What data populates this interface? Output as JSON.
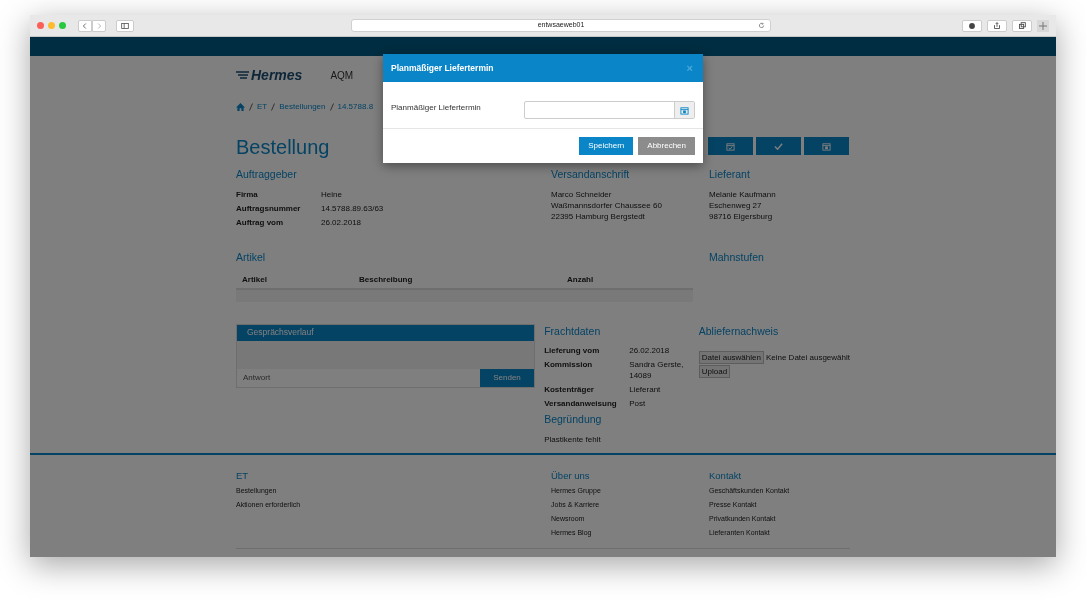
{
  "browser": {
    "url": "entwsaeweb01"
  },
  "header": {
    "logo": "Hermes",
    "app": "AQM"
  },
  "breadcrumb": [
    "ET",
    "Bestellungen",
    "14.5788.8"
  ],
  "page_title": "Bestellung",
  "action_buttons": [
    {
      "kind": "calendar-check"
    },
    {
      "kind": "check"
    },
    {
      "kind": "calendar"
    }
  ],
  "auftraggeber": {
    "heading": "Auftraggeber",
    "fields": [
      {
        "label": "Firma",
        "value": "Heine"
      },
      {
        "label": "Auftragsnummer",
        "value": "14.5788.89.63/63"
      },
      {
        "label": "Auftrag vom",
        "value": "26.02.2018"
      }
    ]
  },
  "versandanschrift": {
    "heading": "Versandanschrift",
    "lines": [
      "Marco Schneider",
      "Waßmannsdorfer Chaussee 60",
      "22395 Hamburg Bergstedt"
    ]
  },
  "lieferant": {
    "heading": "Lieferant",
    "lines": [
      "Melanie Kaufmann",
      "Eschenweg 27",
      "98716 Elgersburg"
    ]
  },
  "artikel": {
    "heading": "Artikel",
    "columns": [
      "Artikel",
      "Beschreibung",
      "Anzahl"
    ]
  },
  "mahnstufen": {
    "heading": "Mahnstufen"
  },
  "chat": {
    "title": "Gesprächsverlauf",
    "placeholder": "Antwort",
    "send": "Senden"
  },
  "frachtdaten": {
    "heading": "Frachtdaten",
    "fields": [
      {
        "label": "Lieferung vom",
        "value": "26.02.2018"
      },
      {
        "label": "Kommission",
        "value": "Sandra Gerste, 14089"
      },
      {
        "label": "Kostenträger",
        "value": "Lieferant"
      },
      {
        "label": "Versandanweisung",
        "value": "Post"
      }
    ]
  },
  "begruendung": {
    "heading": "Begründung",
    "text": "Plastikente fehlt"
  },
  "abliefernachweis": {
    "heading": "Abliefernachweis",
    "choose": "Datei auswählen",
    "no_file": "Keine Datei ausgewählt",
    "upload": "Upload"
  },
  "footer": {
    "columns": [
      {
        "heading": "ET",
        "links": [
          "Bestellungen",
          "Aktionen erforderlich"
        ]
      },
      {
        "heading": "Über uns",
        "links": [
          "Hermes Gruppe",
          "Jobs & Karriere",
          "Newsroom",
          "Hermes Blog"
        ]
      },
      {
        "heading": "Kontakt",
        "links": [
          "Geschäftskunden Kontakt",
          "Presse Kontakt",
          "Privatkunden Kontakt",
          "Lieferanten Kontakt"
        ]
      }
    ]
  },
  "modal": {
    "title": "Planmäßiger Liefertermin",
    "close": "×",
    "label": "Planmäßiger Liefertermin",
    "buttons": [
      {
        "label": "Speichern",
        "kind": "primary"
      },
      {
        "label": "Abbrechen",
        "kind": "secondary"
      }
    ]
  }
}
